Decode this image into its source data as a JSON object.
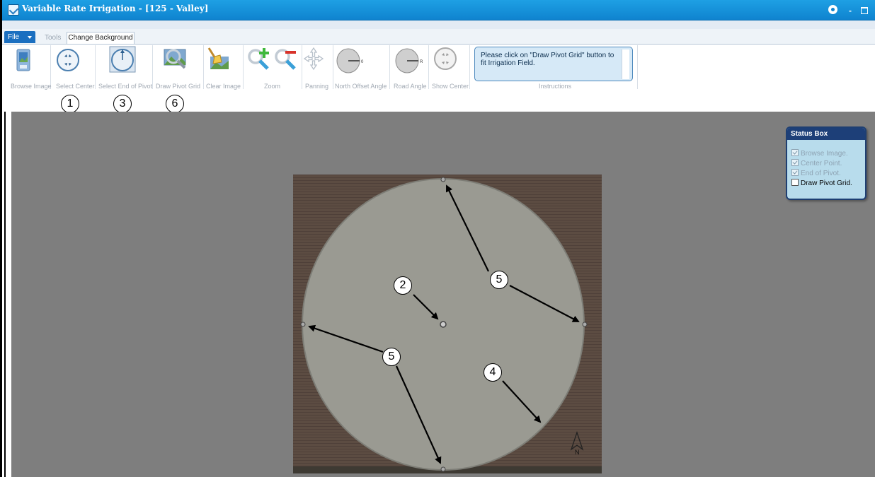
{
  "window": {
    "title": "Variable Rate Irrigation - [125 - Valley]"
  },
  "ribbon": {
    "tabs": [
      {
        "label": "File"
      },
      {
        "label": "Tools"
      },
      {
        "label": "Change Background"
      }
    ],
    "groups": [
      {
        "label": "Browse Image",
        "icon": "browse-image-icon"
      },
      {
        "label": "Select Center",
        "icon": "select-center-icon"
      },
      {
        "label": "Select End of Pivot",
        "icon": "select-end-of-pivot-icon"
      },
      {
        "label": "Draw Pivot Grid",
        "icon": "draw-pivot-grid-icon"
      },
      {
        "label": "Clear Image",
        "icon": "clear-image-icon"
      },
      {
        "label": "Zoom",
        "icon": "zoom-icon"
      },
      {
        "label": "Panning",
        "icon": "panning-icon"
      },
      {
        "label": "North Offset Angle",
        "icon": "north-offset-dial-icon",
        "value": "0"
      },
      {
        "label": "Road Angle",
        "icon": "road-angle-dial-icon",
        "value": "R"
      },
      {
        "label": "Show Center",
        "icon": "show-center-icon"
      },
      {
        "label": "Instructions"
      }
    ],
    "instructions_text": "Please click on \"Draw Pivot Grid\" button to fit Irrigation Field."
  },
  "callouts": [
    "1",
    "3",
    "6",
    "2",
    "5",
    "5",
    "4"
  ],
  "map": {
    "north_label": "N"
  },
  "status_box": {
    "title": "Status Box",
    "items": [
      {
        "label": "Browse Image.",
        "checked": true
      },
      {
        "label": "Center Point.",
        "checked": true
      },
      {
        "label": "End of Pivot.",
        "checked": true
      },
      {
        "label": "Draw Pivot Grid.",
        "checked": false
      }
    ]
  },
  "colors": {
    "titlebar": "#0f83cf",
    "canvas": "#7e7e7e",
    "status_header": "#1d3f78",
    "status_bg": "#b8dcec"
  }
}
